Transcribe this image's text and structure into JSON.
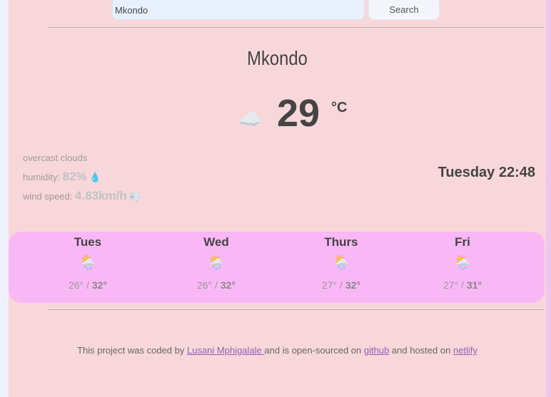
{
  "search": {
    "value": "Mkondo",
    "button_label": "Search"
  },
  "current": {
    "city": "Mkondo",
    "icon": "overcast-cloud-icon",
    "temperature": "29",
    "unit": "°C",
    "description": "overcast clouds",
    "humidity_label": "humidity:",
    "humidity": "82%",
    "wind_label": "wind speed:",
    "wind": "4.83km/h",
    "datetime": "Tuesday 22:48"
  },
  "forecast": [
    {
      "day": "Tues",
      "icon": "sun-cloud-rain-icon",
      "min": "26°",
      "max": "32°"
    },
    {
      "day": "Wed",
      "icon": "sun-cloud-rain-icon",
      "min": "26°",
      "max": "32°"
    },
    {
      "day": "Thurs",
      "icon": "sun-cloud-rain-icon",
      "min": "27°",
      "max": "32°"
    },
    {
      "day": "Fri",
      "icon": "sun-cloud-rain-icon",
      "min": "27°",
      "max": "31°"
    }
  ],
  "footer": {
    "t1": "This project was coded by ",
    "author": "Lusani Mphigalale ",
    "t2": "and is open-sourced on ",
    "github": "github",
    "t3": " and hosted on ",
    "netlify": "netlify"
  },
  "colors": {
    "background": "#f8d7da",
    "forecast_panel": "#f9b8f5",
    "link": "#8d5fb7"
  }
}
